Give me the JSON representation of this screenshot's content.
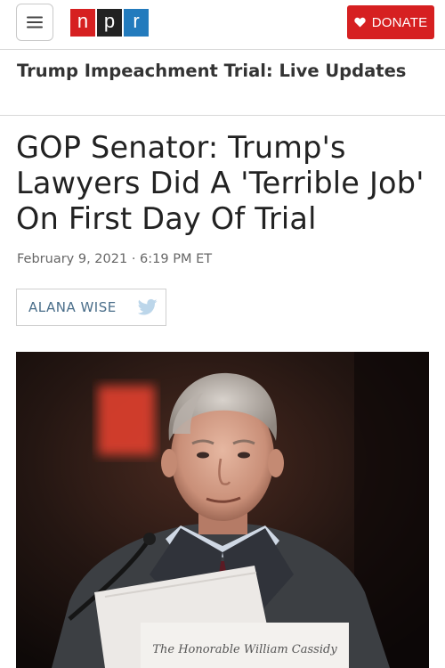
{
  "header": {
    "menu_icon": "hamburger-menu-icon",
    "logo_letters": [
      "n",
      "p",
      "r"
    ],
    "logo_colors": [
      "#d62021",
      "#222222",
      "#237bbd"
    ],
    "donate_label": "DONATE",
    "donate_icon": "heart-icon",
    "donate_color": "#d62021"
  },
  "section": {
    "title": "Trump Impeachment Trial: Live Updates"
  },
  "article": {
    "headline": "GOP Senator: Trump's Lawyers Did A 'Terrible Job' On First Day Of Trial",
    "dateline": "February 9, 2021 · 6:19 PM ET",
    "author": "ALANA WISE",
    "author_icon": "twitter-bird-icon",
    "photo_placard_text": "The Honorable William Cassidy"
  }
}
